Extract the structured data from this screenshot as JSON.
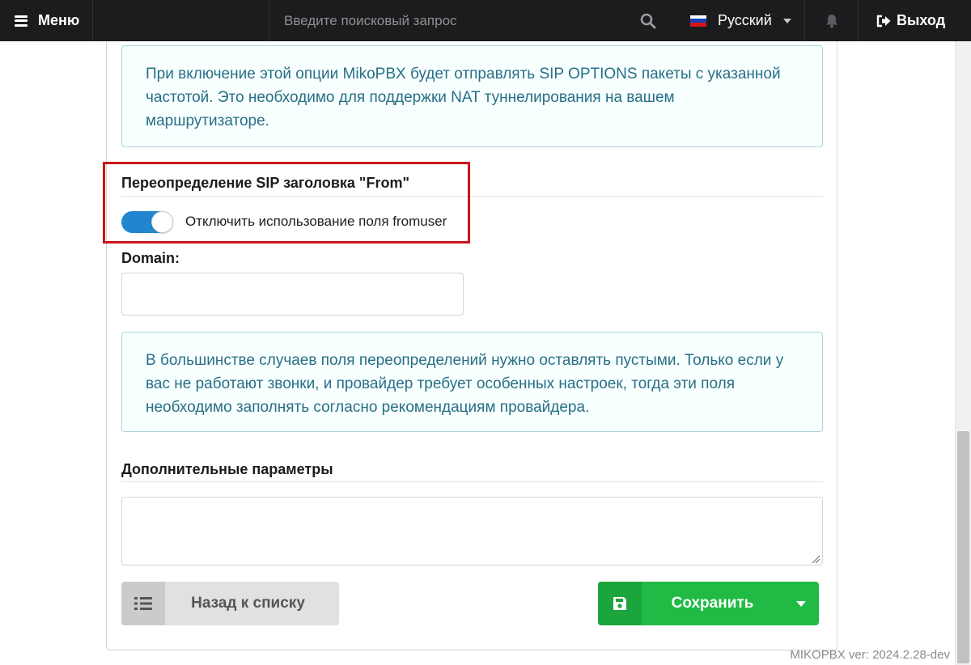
{
  "topbar": {
    "menu_label": "Меню",
    "search_placeholder": "Введите поисковый запрос",
    "language": "Русский",
    "exit_label": "Выход"
  },
  "info_options": "При включение этой опции MikoPBX будет отправлять SIP OPTIONS пакеты с указанной частотой. Это необходимо для поддержки NAT туннелирования на вашем маршрутизаторе.",
  "from_override": {
    "title": "Переопределение SIP заголовка \"From\"",
    "toggle_label": "Отключить использование поля fromuser",
    "toggle_on": true
  },
  "domain": {
    "label": "Domain:",
    "value": ""
  },
  "info_overrides": "В большинстве случаев поля переопределений нужно оставлять пустыми. Только если у вас не работают звонки, и провайдер требует особенных настроек, тогда эти поля необходимо заполнять согласно рекомендациям провайдера.",
  "additional": {
    "title": "Дополнительные параметры",
    "value": ""
  },
  "buttons": {
    "back_label": "Назад к списку",
    "save_label": "Сохранить"
  },
  "version": "MIKOPBX ver: 2024.2.28-dev",
  "colors": {
    "accent_blue": "#2185d0",
    "save_green": "#21ba45",
    "highlight_red": "#c7151c",
    "info_text": "#276f86"
  }
}
